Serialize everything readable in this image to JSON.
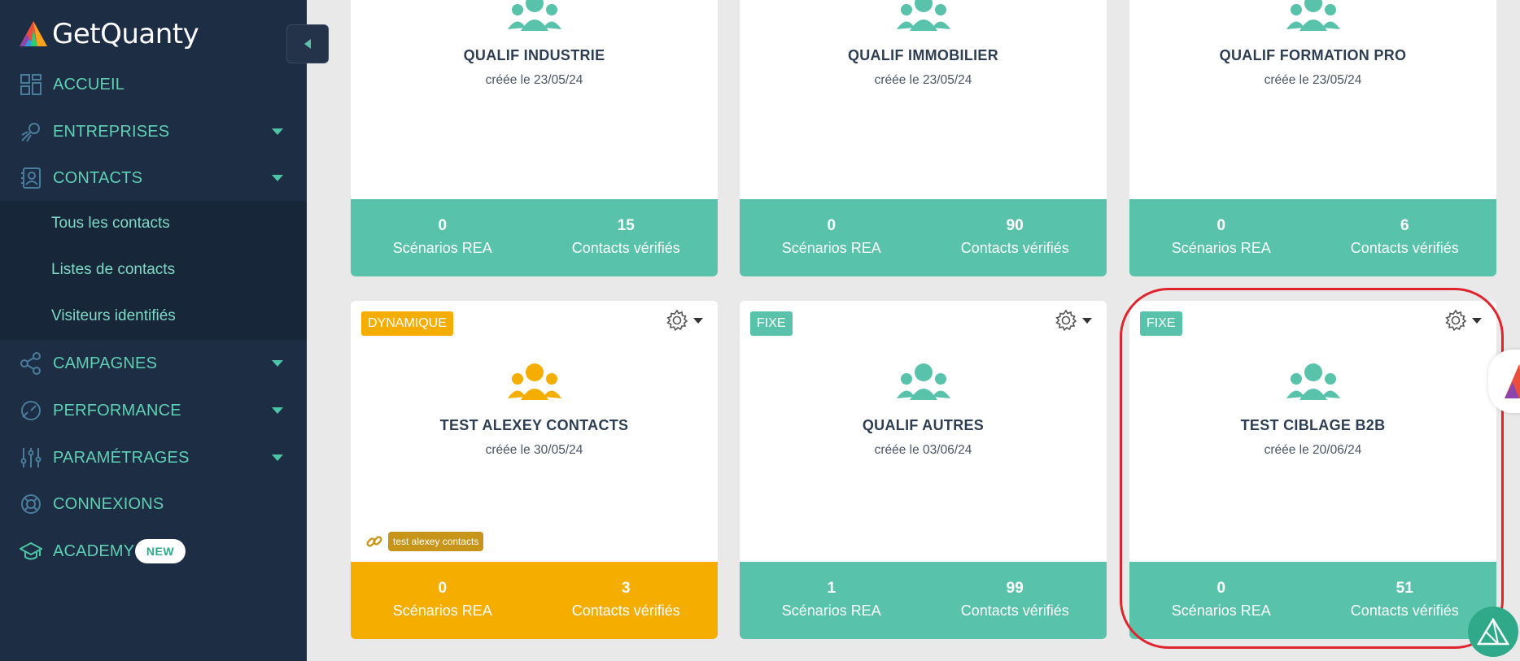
{
  "brand": {
    "name": "GetQuanty"
  },
  "sidebar": {
    "items": [
      {
        "label": "ACCUEIL",
        "icon": "dashboard-icon",
        "has_caret": false
      },
      {
        "label": "ENTREPRISES",
        "icon": "rocket-icon",
        "has_caret": true
      },
      {
        "label": "CONTACTS",
        "icon": "contact-card-icon",
        "has_caret": true
      },
      {
        "label": "CAMPAGNES",
        "icon": "share-nodes-icon",
        "has_caret": true
      },
      {
        "label": "PERFORMANCE",
        "icon": "gauge-icon",
        "has_caret": true
      },
      {
        "label": "PARAMÉTRAGES",
        "icon": "sliders-icon",
        "has_caret": true
      },
      {
        "label": "CONNEXIONS",
        "icon": "lifebuoy-icon",
        "has_caret": false
      },
      {
        "label": "ACADEMY",
        "icon": "graduation-cap-icon",
        "has_caret": false,
        "badge": "NEW"
      }
    ],
    "contacts_submenu": [
      "Tous les contacts",
      "Listes de contacts",
      "Visiteurs identifiés"
    ]
  },
  "cards": [
    {
      "title": "QUALIF INDUSTRIE",
      "date": "créée le 23/05/24",
      "scenarios": "0",
      "scenarios_label": "Scénarios REA",
      "contacts": "15",
      "contacts_label": "Contacts vérifiés",
      "color": "green"
    },
    {
      "title": "QUALIF IMMOBILIER",
      "date": "créée le 23/05/24",
      "scenarios": "0",
      "scenarios_label": "Scénarios REA",
      "contacts": "90",
      "contacts_label": "Contacts vérifiés",
      "color": "green"
    },
    {
      "title": "QUALIF FORMATION PRO",
      "date": "créée le 23/05/24",
      "scenarios": "0",
      "scenarios_label": "Scénarios REA",
      "contacts": "6",
      "contacts_label": "Contacts vérifiés",
      "color": "green"
    },
    {
      "type": "DYNAMIQUE",
      "title": "TEST ALEXEY CONTACTS",
      "date": "créée le 30/05/24",
      "tag": "test alexey contacts",
      "scenarios": "0",
      "scenarios_label": "Scénarios REA",
      "contacts": "3",
      "contacts_label": "Contacts vérifiés",
      "color": "orange"
    },
    {
      "type": "FIXE",
      "title": "QUALIF AUTRES",
      "date": "créée le 03/06/24",
      "scenarios": "1",
      "scenarios_label": "Scénarios REA",
      "contacts": "99",
      "contacts_label": "Contacts vérifiés",
      "color": "green"
    },
    {
      "type": "FIXE",
      "title": "TEST CIBLAGE B2B",
      "date": "créée le 20/06/24",
      "scenarios": "0",
      "scenarios_label": "Scénarios REA",
      "contacts": "51",
      "contacts_label": "Contacts vérifiés",
      "color": "green"
    }
  ],
  "colors": {
    "sidebar_bg": "#1d2d44",
    "accent_green": "#58c3aa",
    "accent_orange": "#f5ad00",
    "highlight_red": "#e0242d"
  }
}
